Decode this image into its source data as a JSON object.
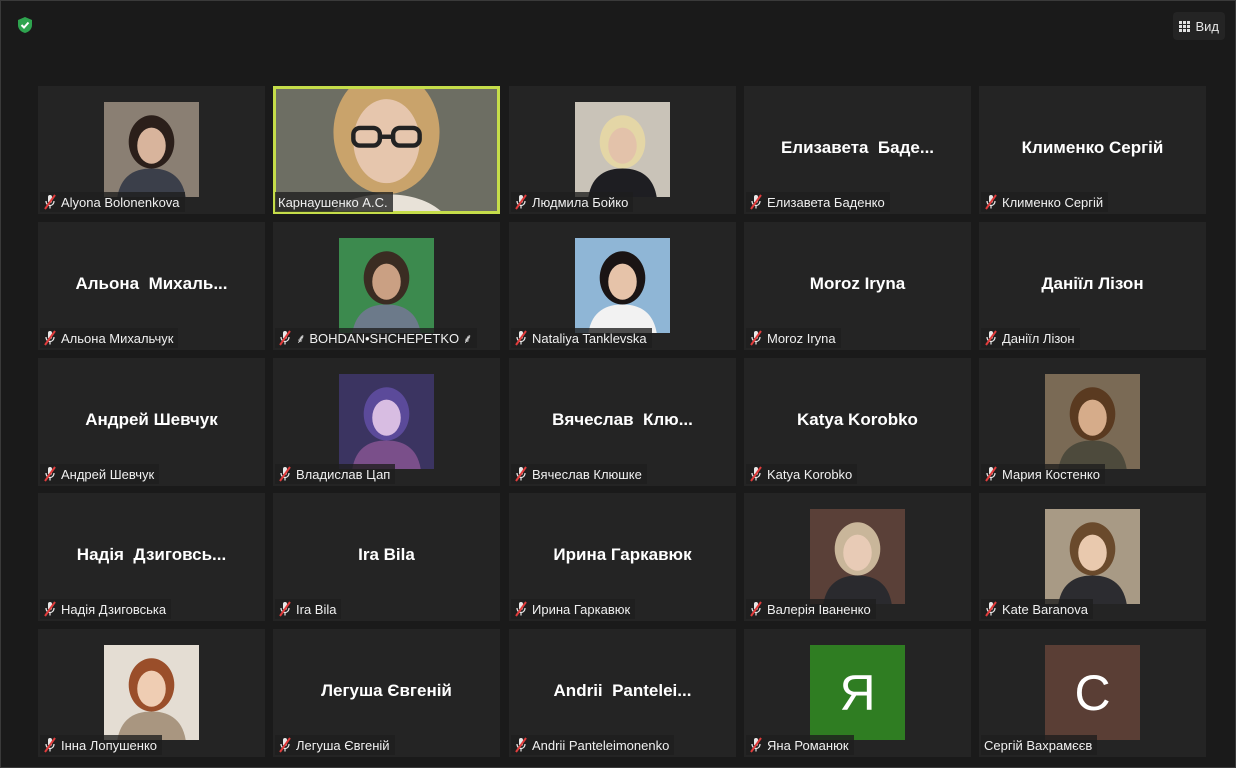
{
  "top_bar": {
    "security_icon": "shield-check-icon",
    "view_label": "Вид",
    "view_icon": "grid-icon"
  },
  "colors": {
    "background": "#1a1a1a",
    "tile": "#242424",
    "active_speaker_border": "#c5dd4a",
    "shield": "#2ea44f",
    "muted_mic": "#e03c3c"
  },
  "participants": [
    {
      "label": "Alyona Bolonenkova",
      "display": "photo",
      "muted": true
    },
    {
      "label": "Карнаушенко А.С.",
      "display": "photo",
      "muted": false,
      "active_speaker": true
    },
    {
      "label": "Людмила Бойко",
      "display": "photo",
      "muted": true
    },
    {
      "label": "Елизавета Баденко",
      "display": "name",
      "big_name": "Елизавета  Баде...",
      "muted": true
    },
    {
      "label": "Клименко Сергій",
      "display": "name",
      "big_name": "Клименко Сергій",
      "muted": true
    },
    {
      "label": "Альона Михальчук",
      "display": "name",
      "big_name": "Альона  Михаль...",
      "muted": true
    },
    {
      "label": "⸙ BOHDAN•SHCHEPETKO ⸙",
      "display": "photo",
      "muted": true
    },
    {
      "label": "Nataliya Tanklevska",
      "display": "photo",
      "muted": true
    },
    {
      "label": "Moroz Iryna",
      "display": "name",
      "big_name": "Moroz Iryna",
      "muted": true
    },
    {
      "label": "Даніїл Лізон",
      "display": "name",
      "big_name": "Даніїл Лізон",
      "muted": true
    },
    {
      "label": "Андрей Шевчук",
      "display": "name",
      "big_name": "Андрей Шевчук",
      "muted": true
    },
    {
      "label": "Владислав Цап",
      "display": "photo",
      "muted": true
    },
    {
      "label": "Вячеслав Клюшке",
      "display": "name",
      "big_name": "Вячеслав  Клю...",
      "muted": true
    },
    {
      "label": "Katya Korobko",
      "display": "name",
      "big_name": "Katya Korobko",
      "muted": true
    },
    {
      "label": "Мария Костенко",
      "display": "photo",
      "muted": true
    },
    {
      "label": "Надія Дзиговська",
      "display": "name",
      "big_name": "Надія  Дзиговсь...",
      "muted": true
    },
    {
      "label": "Ira Bila",
      "display": "name",
      "big_name": "Ira Bila",
      "muted": true
    },
    {
      "label": "Ирина Гаркавюк",
      "display": "name",
      "big_name": "Ирина Гаркавюк",
      "muted": true
    },
    {
      "label": "Валерія Іваненко",
      "display": "photo",
      "muted": true
    },
    {
      "label": "Kate Baranova",
      "display": "photo",
      "muted": true
    },
    {
      "label": "Інна Лопушенко",
      "display": "photo",
      "muted": true
    },
    {
      "label": "Легуша Євгеній",
      "display": "name",
      "big_name": "Легуша Євгеній",
      "muted": true
    },
    {
      "label": "Andrii Panteleimonenko",
      "display": "name",
      "big_name": "Andrii  Pantelei...",
      "muted": true
    },
    {
      "label": "Яна Романюк",
      "display": "letter",
      "letter": "Я",
      "avatar_color": "#2f7d22",
      "muted": true
    },
    {
      "label": "Сергій Вахрамєєв",
      "display": "letter",
      "letter": "С",
      "avatar_color": "#5a3e35",
      "muted": false
    }
  ]
}
